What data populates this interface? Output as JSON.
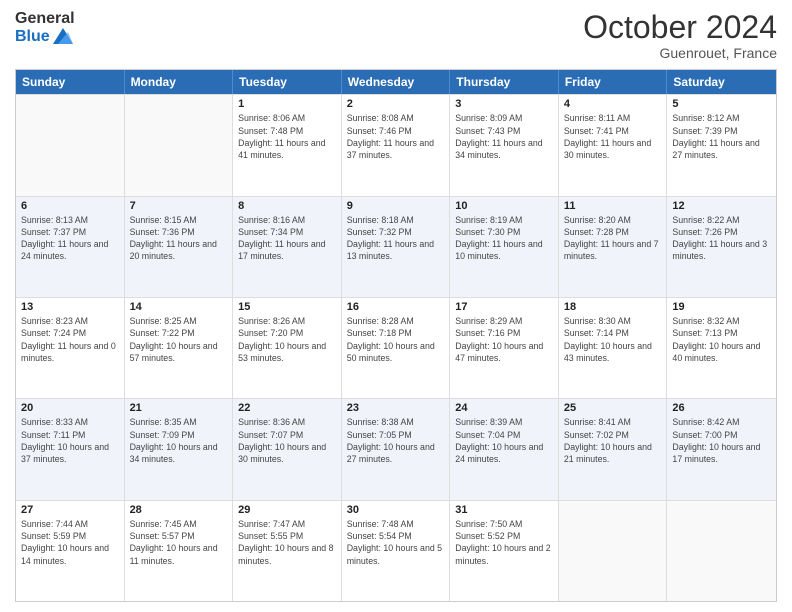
{
  "header": {
    "logo_line1": "General",
    "logo_line2": "Blue",
    "month": "October 2024",
    "location": "Guenrouet, France"
  },
  "days_of_week": [
    "Sunday",
    "Monday",
    "Tuesday",
    "Wednesday",
    "Thursday",
    "Friday",
    "Saturday"
  ],
  "weeks": [
    [
      {
        "day": "",
        "sunrise": "",
        "sunset": "",
        "daylight": ""
      },
      {
        "day": "",
        "sunrise": "",
        "sunset": "",
        "daylight": ""
      },
      {
        "day": "1",
        "sunrise": "Sunrise: 8:06 AM",
        "sunset": "Sunset: 7:48 PM",
        "daylight": "Daylight: 11 hours and 41 minutes."
      },
      {
        "day": "2",
        "sunrise": "Sunrise: 8:08 AM",
        "sunset": "Sunset: 7:46 PM",
        "daylight": "Daylight: 11 hours and 37 minutes."
      },
      {
        "day": "3",
        "sunrise": "Sunrise: 8:09 AM",
        "sunset": "Sunset: 7:43 PM",
        "daylight": "Daylight: 11 hours and 34 minutes."
      },
      {
        "day": "4",
        "sunrise": "Sunrise: 8:11 AM",
        "sunset": "Sunset: 7:41 PM",
        "daylight": "Daylight: 11 hours and 30 minutes."
      },
      {
        "day": "5",
        "sunrise": "Sunrise: 8:12 AM",
        "sunset": "Sunset: 7:39 PM",
        "daylight": "Daylight: 11 hours and 27 minutes."
      }
    ],
    [
      {
        "day": "6",
        "sunrise": "Sunrise: 8:13 AM",
        "sunset": "Sunset: 7:37 PM",
        "daylight": "Daylight: 11 hours and 24 minutes."
      },
      {
        "day": "7",
        "sunrise": "Sunrise: 8:15 AM",
        "sunset": "Sunset: 7:36 PM",
        "daylight": "Daylight: 11 hours and 20 minutes."
      },
      {
        "day": "8",
        "sunrise": "Sunrise: 8:16 AM",
        "sunset": "Sunset: 7:34 PM",
        "daylight": "Daylight: 11 hours and 17 minutes."
      },
      {
        "day": "9",
        "sunrise": "Sunrise: 8:18 AM",
        "sunset": "Sunset: 7:32 PM",
        "daylight": "Daylight: 11 hours and 13 minutes."
      },
      {
        "day": "10",
        "sunrise": "Sunrise: 8:19 AM",
        "sunset": "Sunset: 7:30 PM",
        "daylight": "Daylight: 11 hours and 10 minutes."
      },
      {
        "day": "11",
        "sunrise": "Sunrise: 8:20 AM",
        "sunset": "Sunset: 7:28 PM",
        "daylight": "Daylight: 11 hours and 7 minutes."
      },
      {
        "day": "12",
        "sunrise": "Sunrise: 8:22 AM",
        "sunset": "Sunset: 7:26 PM",
        "daylight": "Daylight: 11 hours and 3 minutes."
      }
    ],
    [
      {
        "day": "13",
        "sunrise": "Sunrise: 8:23 AM",
        "sunset": "Sunset: 7:24 PM",
        "daylight": "Daylight: 11 hours and 0 minutes."
      },
      {
        "day": "14",
        "sunrise": "Sunrise: 8:25 AM",
        "sunset": "Sunset: 7:22 PM",
        "daylight": "Daylight: 10 hours and 57 minutes."
      },
      {
        "day": "15",
        "sunrise": "Sunrise: 8:26 AM",
        "sunset": "Sunset: 7:20 PM",
        "daylight": "Daylight: 10 hours and 53 minutes."
      },
      {
        "day": "16",
        "sunrise": "Sunrise: 8:28 AM",
        "sunset": "Sunset: 7:18 PM",
        "daylight": "Daylight: 10 hours and 50 minutes."
      },
      {
        "day": "17",
        "sunrise": "Sunrise: 8:29 AM",
        "sunset": "Sunset: 7:16 PM",
        "daylight": "Daylight: 10 hours and 47 minutes."
      },
      {
        "day": "18",
        "sunrise": "Sunrise: 8:30 AM",
        "sunset": "Sunset: 7:14 PM",
        "daylight": "Daylight: 10 hours and 43 minutes."
      },
      {
        "day": "19",
        "sunrise": "Sunrise: 8:32 AM",
        "sunset": "Sunset: 7:13 PM",
        "daylight": "Daylight: 10 hours and 40 minutes."
      }
    ],
    [
      {
        "day": "20",
        "sunrise": "Sunrise: 8:33 AM",
        "sunset": "Sunset: 7:11 PM",
        "daylight": "Daylight: 10 hours and 37 minutes."
      },
      {
        "day": "21",
        "sunrise": "Sunrise: 8:35 AM",
        "sunset": "Sunset: 7:09 PM",
        "daylight": "Daylight: 10 hours and 34 minutes."
      },
      {
        "day": "22",
        "sunrise": "Sunrise: 8:36 AM",
        "sunset": "Sunset: 7:07 PM",
        "daylight": "Daylight: 10 hours and 30 minutes."
      },
      {
        "day": "23",
        "sunrise": "Sunrise: 8:38 AM",
        "sunset": "Sunset: 7:05 PM",
        "daylight": "Daylight: 10 hours and 27 minutes."
      },
      {
        "day": "24",
        "sunrise": "Sunrise: 8:39 AM",
        "sunset": "Sunset: 7:04 PM",
        "daylight": "Daylight: 10 hours and 24 minutes."
      },
      {
        "day": "25",
        "sunrise": "Sunrise: 8:41 AM",
        "sunset": "Sunset: 7:02 PM",
        "daylight": "Daylight: 10 hours and 21 minutes."
      },
      {
        "day": "26",
        "sunrise": "Sunrise: 8:42 AM",
        "sunset": "Sunset: 7:00 PM",
        "daylight": "Daylight: 10 hours and 17 minutes."
      }
    ],
    [
      {
        "day": "27",
        "sunrise": "Sunrise: 7:44 AM",
        "sunset": "Sunset: 5:59 PM",
        "daylight": "Daylight: 10 hours and 14 minutes."
      },
      {
        "day": "28",
        "sunrise": "Sunrise: 7:45 AM",
        "sunset": "Sunset: 5:57 PM",
        "daylight": "Daylight: 10 hours and 11 minutes."
      },
      {
        "day": "29",
        "sunrise": "Sunrise: 7:47 AM",
        "sunset": "Sunset: 5:55 PM",
        "daylight": "Daylight: 10 hours and 8 minutes."
      },
      {
        "day": "30",
        "sunrise": "Sunrise: 7:48 AM",
        "sunset": "Sunset: 5:54 PM",
        "daylight": "Daylight: 10 hours and 5 minutes."
      },
      {
        "day": "31",
        "sunrise": "Sunrise: 7:50 AM",
        "sunset": "Sunset: 5:52 PM",
        "daylight": "Daylight: 10 hours and 2 minutes."
      },
      {
        "day": "",
        "sunrise": "",
        "sunset": "",
        "daylight": ""
      },
      {
        "day": "",
        "sunrise": "",
        "sunset": "",
        "daylight": ""
      }
    ]
  ]
}
